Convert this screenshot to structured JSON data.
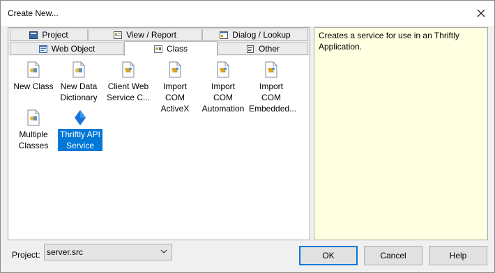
{
  "window": {
    "title": "Create New..."
  },
  "tabs": {
    "row1": [
      "Project",
      "View / Report",
      "Dialog / Lookup"
    ],
    "row2": [
      "Web Object",
      "Class",
      "Other"
    ],
    "active": "Class"
  },
  "items": [
    {
      "line1": "New Class",
      "line2": "",
      "selected": false
    },
    {
      "line1": "New Data",
      "line2": "Dictionary",
      "selected": false
    },
    {
      "line1": "Client Web",
      "line2": "Service C...",
      "selected": false
    },
    {
      "line1": "Import COM",
      "line2": "ActiveX",
      "selected": false
    },
    {
      "line1": "Import COM",
      "line2": "Automation",
      "selected": false
    },
    {
      "line1": "Import COM",
      "line2": "Embedded...",
      "selected": false
    },
    {
      "line1": "Multiple",
      "line2": "Classes",
      "selected": false
    },
    {
      "line1": "Thriftly API",
      "line2": "Service",
      "selected": true
    }
  ],
  "description": "Creates a service for use in an Thriftly Application.",
  "project": {
    "label": "Project:",
    "value": "server.src"
  },
  "buttons": {
    "ok": "OK",
    "cancel": "Cancel",
    "help": "Help"
  },
  "colors": {
    "selection": "#0078d7",
    "description_bg": "#ffffe1"
  }
}
